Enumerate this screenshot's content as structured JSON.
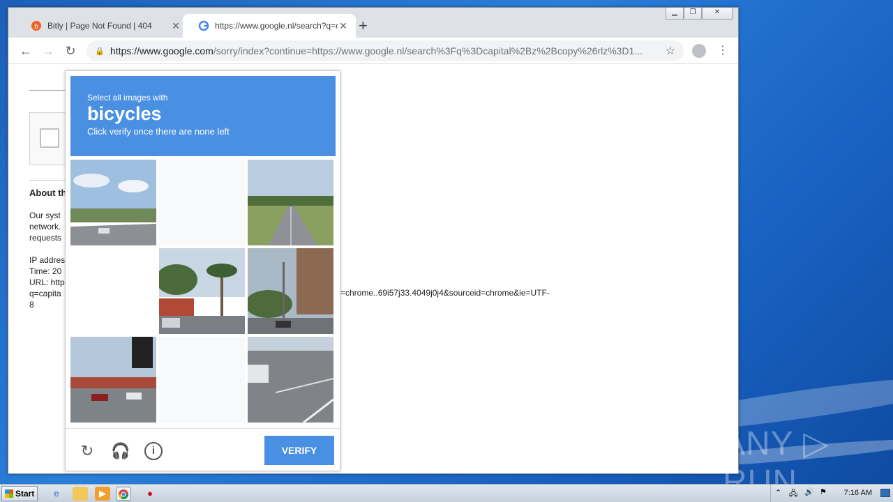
{
  "browser": {
    "tabs": [
      {
        "title": "Bitly | Page Not Found | 404",
        "close": "✕"
      },
      {
        "title": "https://www.google.nl/search?q=ca",
        "close": "✕"
      }
    ],
    "new_tab": "+",
    "address": {
      "host": "https://www.google.com",
      "path": "/sorry/index?continue=https://www.google.nl/search%3Fq%3Dcapital%2Bz%2Bcopy%26rlz%3D1..."
    }
  },
  "page": {
    "about_heading": "About th",
    "para1": [
      "Our syst",
      "network.",
      "requests"
    ],
    "para2": [
      "IP addres",
      "Time: 20",
      "URL: http",
      "q=capita",
      "8"
    ],
    "url_tail": "=chrome..69i57j33.4049j0j4&sourceid=chrome&ie=UTF-"
  },
  "captcha": {
    "instruction_line1": "Select all images with",
    "object": "bicycles",
    "instruction_line3": "Click verify once there are none left",
    "verify_label": "VERIFY"
  },
  "taskbar": {
    "start_label": "Start",
    "clock": "7:16 AM"
  },
  "watermark": "ANY ▷ RUN"
}
